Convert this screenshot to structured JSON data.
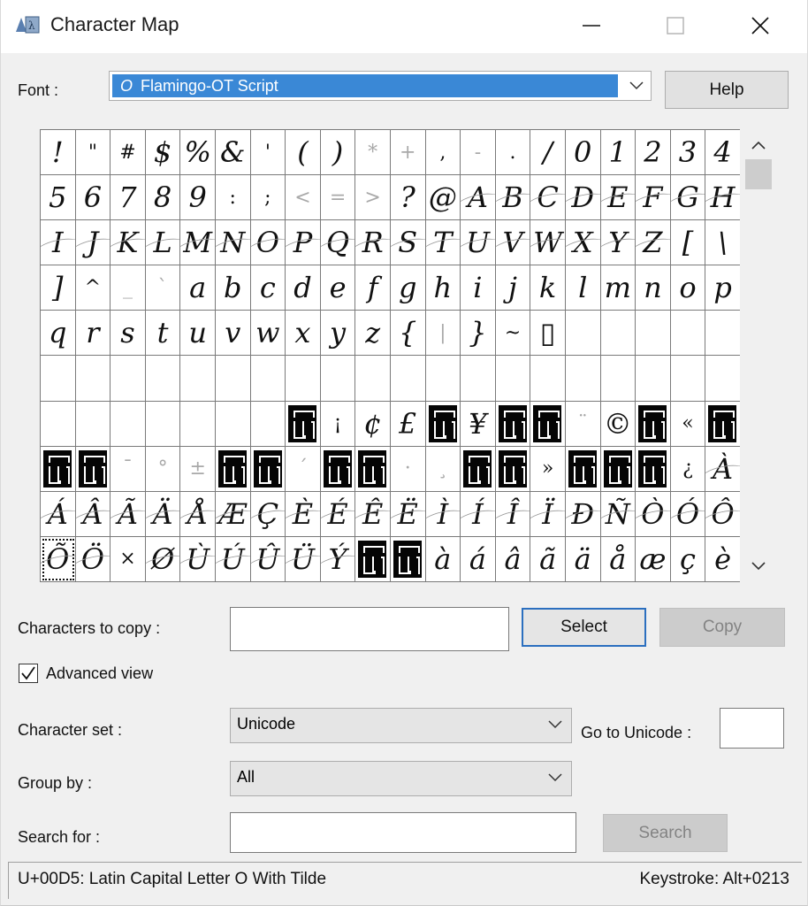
{
  "window": {
    "title": "Character Map",
    "controls": [
      "minimize",
      "maximize",
      "close"
    ]
  },
  "font": {
    "label": "Font :",
    "icon": "opentype-font-icon",
    "icon_glyph": "O",
    "selected": "Flamingo-OT Script",
    "help_label": "Help"
  },
  "grid": {
    "rows": [
      [
        "!",
        "\"",
        "#",
        "$",
        "%",
        "&",
        "'",
        "(",
        ")",
        "*",
        "+",
        ",",
        "-",
        ".",
        "/",
        "0",
        "1",
        "2",
        "3",
        "4"
      ],
      [
        "5",
        "6",
        "7",
        "8",
        "9",
        ":",
        ";",
        "<",
        "=",
        ">",
        "?",
        "@",
        "A",
        "B",
        "C",
        "D",
        "E",
        "F",
        "G",
        "H"
      ],
      [
        "I",
        "J",
        "K",
        "L",
        "M",
        "N",
        "O",
        "P",
        "Q",
        "R",
        "S",
        "T",
        "U",
        "V",
        "W",
        "X",
        "Y",
        "Z",
        "[",
        "\\"
      ],
      [
        "]",
        "^",
        "_",
        "`",
        "a",
        "b",
        "c",
        "d",
        "e",
        "f",
        "g",
        "h",
        "i",
        "j",
        "k",
        "l",
        "m",
        "n",
        "o",
        "p"
      ],
      [
        "q",
        "r",
        "s",
        "t",
        "u",
        "v",
        "w",
        "x",
        "y",
        "z",
        "{",
        "|",
        "}",
        "~",
        "▯",
        "",
        "",
        "",
        "",
        ""
      ],
      [
        "",
        "",
        "",
        "",
        "",
        "",
        "",
        "",
        "",
        "",
        "",
        "",
        "",
        "",
        "",
        "",
        "",
        "",
        "",
        ""
      ],
      [
        "",
        "",
        "",
        "",
        "",
        "",
        "",
        "■",
        "¡",
        "¢",
        "£",
        "■",
        "¥",
        "■",
        "■",
        "¨",
        "©",
        "■",
        "«",
        "■"
      ],
      [
        "■",
        "■",
        "¯",
        "°",
        "±",
        "■",
        "■",
        "´",
        "■",
        "■",
        "·",
        "¸",
        "■",
        "■",
        "»",
        "■",
        "■",
        "■",
        "¿",
        "À"
      ],
      [
        "Á",
        "Â",
        "Ã",
        "Ä",
        "Å",
        "Æ",
        "Ç",
        "È",
        "É",
        "Ê",
        "Ë",
        "Ì",
        "Í",
        "Î",
        "Ï",
        "Ð",
        "Ñ",
        "Ò",
        "Ó",
        "Ô"
      ],
      [
        "Õ",
        "Ö",
        "×",
        "Ø",
        "Ù",
        "Ú",
        "Û",
        "Ü",
        "Ý",
        "■",
        "■",
        "à",
        "á",
        "â",
        "ã",
        "ä",
        "å",
        "æ",
        "ç",
        "è"
      ]
    ],
    "selected_char": "Õ"
  },
  "copy": {
    "label": "Characters to copy :",
    "value": "",
    "select_label": "Select",
    "copy_label": "Copy"
  },
  "advanced": {
    "label": "Advanced view",
    "checked": true
  },
  "charset": {
    "label": "Character set :",
    "value": "Unicode",
    "goto_label": "Go to Unicode :",
    "goto_value": ""
  },
  "groupby": {
    "label": "Group by :",
    "value": "All"
  },
  "search": {
    "label": "Search for :",
    "value": "",
    "button_label": "Search"
  },
  "status": {
    "description": "U+00D5: Latin Capital Letter O With Tilde",
    "keystroke": "Keystroke: Alt+0213"
  }
}
